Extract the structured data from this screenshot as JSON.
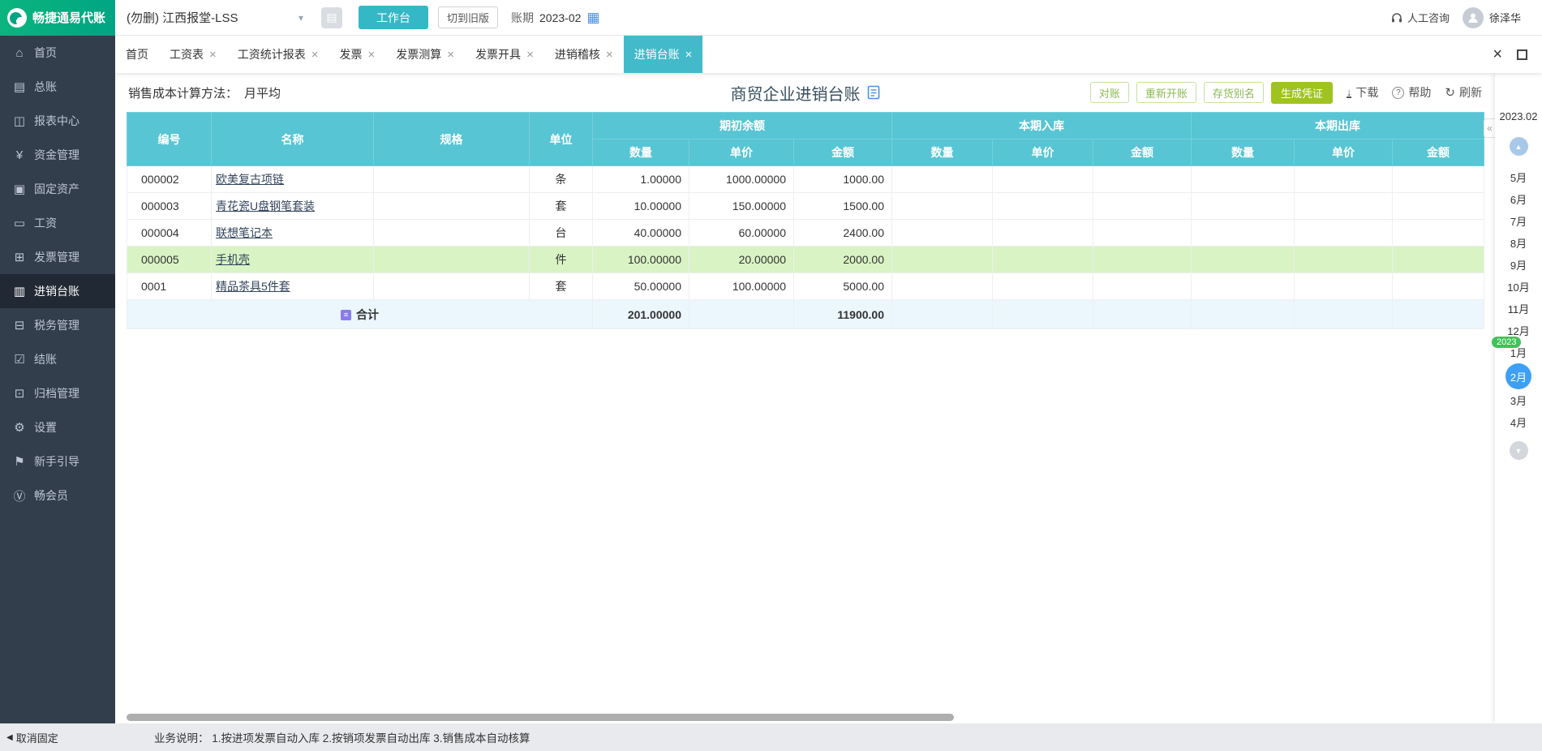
{
  "topbar": {
    "logo": "畅捷通易代账",
    "company": "(勿删) 江西报堂-LSS",
    "workbench": "工作台",
    "switch_old": "切到旧版",
    "period_label": "账期",
    "period_value": "2023-02",
    "support": "人工咨询",
    "user": "徐泽华"
  },
  "sidebar": {
    "items": [
      {
        "label": "首页",
        "icon": "home-icon"
      },
      {
        "label": "总账",
        "icon": "general-ledger-icon"
      },
      {
        "label": "报表中心",
        "icon": "report-center-icon"
      },
      {
        "label": "资金管理",
        "icon": "funds-icon"
      },
      {
        "label": "固定资产",
        "icon": "fixed-assets-icon"
      },
      {
        "label": "工资",
        "icon": "salary-icon"
      },
      {
        "label": "发票管理",
        "icon": "invoice-icon"
      },
      {
        "label": "进销台账",
        "icon": "purchase-sales-ledger-icon",
        "active": true
      },
      {
        "label": "税务管理",
        "icon": "tax-icon"
      },
      {
        "label": "结账",
        "icon": "closing-icon"
      },
      {
        "label": "归档管理",
        "icon": "archive-icon"
      },
      {
        "label": "设置",
        "icon": "settings-icon"
      },
      {
        "label": "新手引导",
        "icon": "guide-icon"
      },
      {
        "label": "畅会员",
        "icon": "member-icon"
      }
    ],
    "unpin": "取消固定"
  },
  "tabs": {
    "items": [
      {
        "label": "首页",
        "closable": false
      },
      {
        "label": "工资表",
        "closable": true
      },
      {
        "label": "工资统计报表",
        "closable": true
      },
      {
        "label": "发票",
        "closable": true
      },
      {
        "label": "发票测算",
        "closable": true
      },
      {
        "label": "发票开具",
        "closable": true
      },
      {
        "label": "进销稽核",
        "closable": true
      },
      {
        "label": "进销台账",
        "closable": true,
        "active": true
      }
    ],
    "active": "进销台账"
  },
  "page": {
    "cost_method_label": "销售成本计算方法：",
    "cost_method_value": "月平均",
    "title": "商贸企业进销台账",
    "btn_reconcile": "对账",
    "btn_reopen": "重新开账",
    "btn_alias": "存货别名",
    "btn_voucher": "生成凭证",
    "tool_download": "下载",
    "tool_help": "帮助",
    "tool_refresh": "刷新"
  },
  "table": {
    "col_code": "编号",
    "col_name": "名称",
    "col_spec": "规格",
    "col_unit": "单位",
    "group_opening": "期初余额",
    "group_in": "本期入库",
    "group_out": "本期出库",
    "sub_qty": "数量",
    "sub_price": "单价",
    "sub_amount": "金额",
    "rows": [
      {
        "code": "000002",
        "name": "欧美复古项链",
        "spec": "",
        "unit": "条",
        "opening": {
          "qty": "1.00000",
          "price": "1000.00000",
          "amount": "1000.00"
        },
        "inbound": {
          "qty": "",
          "price": "",
          "amount": ""
        },
        "outbound": {
          "qty": "",
          "price": "",
          "amount": ""
        }
      },
      {
        "code": "000003",
        "name": "青花瓷U盘钢笔套装",
        "spec": "",
        "unit": "套",
        "opening": {
          "qty": "10.00000",
          "price": "150.00000",
          "amount": "1500.00"
        },
        "inbound": {
          "qty": "",
          "price": "",
          "amount": ""
        },
        "outbound": {
          "qty": "",
          "price": "",
          "amount": ""
        }
      },
      {
        "code": "000004",
        "name": "联想笔记本",
        "spec": "",
        "unit": "台",
        "opening": {
          "qty": "40.00000",
          "price": "60.00000",
          "amount": "2400.00"
        },
        "inbound": {
          "qty": "",
          "price": "",
          "amount": ""
        },
        "outbound": {
          "qty": "",
          "price": "",
          "amount": ""
        }
      },
      {
        "code": "000005",
        "name": "手机壳",
        "spec": "",
        "unit": "件",
        "highlighted": true,
        "opening": {
          "qty": "100.00000",
          "price": "20.00000",
          "amount": "2000.00"
        },
        "inbound": {
          "qty": "",
          "price": "",
          "amount": ""
        },
        "outbound": {
          "qty": "",
          "price": "",
          "amount": ""
        }
      },
      {
        "code": "0001",
        "name": "精品茶具5件套",
        "spec": "",
        "unit": "套",
        "opening": {
          "qty": "50.00000",
          "price": "100.00000",
          "amount": "5000.00"
        },
        "inbound": {
          "qty": "",
          "price": "",
          "amount": ""
        },
        "outbound": {
          "qty": "",
          "price": "",
          "amount": ""
        }
      }
    ],
    "total_label": "合计",
    "total_qty": "201.00000",
    "total_amount": "11900.00"
  },
  "month_rail": {
    "period": "2023.02",
    "year_badge": "2023",
    "months": [
      "5月",
      "6月",
      "7月",
      "8月",
      "9月",
      "10月",
      "11月",
      "12月",
      "1月",
      "2月",
      "3月",
      "4月"
    ],
    "active": "2月"
  },
  "footer": {
    "note": "业务说明： 1.按进项发票自动入库  2.按销项发票自动出库  3.销售成本自动核算"
  },
  "icons": {
    "company_dropdown": "chevron-down",
    "calendar": "calendar",
    "support": "headset",
    "avatar": "user",
    "title_doc": "document",
    "download": "download-arrow",
    "help": "question-circle",
    "refresh": "refresh-arrow",
    "rail_up": "chevron-up-circle",
    "rail_down": "chevron-down-circle",
    "collapse": "double-chevron-left",
    "unpin": "left-triangle",
    "sum": "calculator"
  }
}
